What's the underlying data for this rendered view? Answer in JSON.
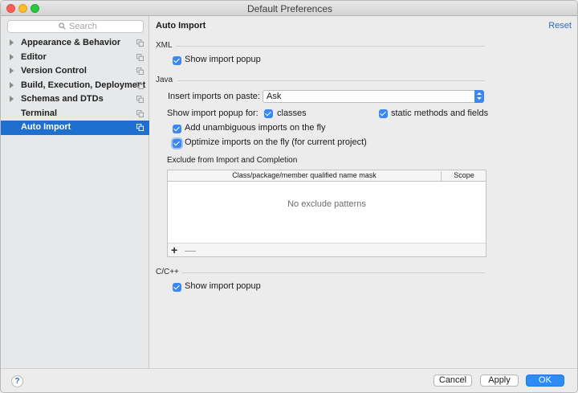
{
  "window": {
    "title": "Default Preferences"
  },
  "sidebar": {
    "search_placeholder": "Search",
    "items": [
      {
        "label": "Appearance & Behavior",
        "expandable": true
      },
      {
        "label": "Editor",
        "expandable": true
      },
      {
        "label": "Version Control",
        "expandable": true
      },
      {
        "label": "Build, Execution, Deployment",
        "expandable": true
      },
      {
        "label": "Schemas and DTDs",
        "expandable": true
      },
      {
        "label": "Terminal",
        "expandable": false
      },
      {
        "label": "Auto Import",
        "expandable": false,
        "selected": true
      }
    ]
  },
  "page": {
    "title": "Auto Import",
    "reset_label": "Reset",
    "xml": {
      "section_label": "XML",
      "show_popup_label": "Show import popup",
      "show_popup_checked": true
    },
    "java": {
      "section_label": "Java",
      "insert_label": "Insert imports on paste:",
      "insert_value": "Ask",
      "show_popup_for_label": "Show import popup for:",
      "classes_label": "classes",
      "classes_checked": true,
      "static_label": "static methods and fields",
      "static_checked": true,
      "unambiguous_label": "Add unambiguous imports on the fly",
      "unambiguous_checked": true,
      "optimize_label": "Optimize imports on the fly (for current project)",
      "optimize_checked": true
    },
    "exclude": {
      "title": "Exclude from Import and Completion",
      "columns": [
        "Class/package/member qualified name mask",
        "Scope"
      ],
      "empty_text": "No exclude patterns",
      "add_symbol": "+",
      "remove_symbol": "—"
    },
    "cpp": {
      "section_label": "C/C++",
      "show_popup_label": "Show import popup",
      "show_popup_checked": true
    }
  },
  "footer": {
    "help_symbol": "?",
    "cancel_label": "Cancel",
    "apply_label": "Apply",
    "ok_label": "OK"
  },
  "colors": {
    "selection": "#1f6fd0",
    "checkbox": "#3b88f0",
    "ok_button": "#2f8bf5",
    "link": "#2f6db5"
  }
}
